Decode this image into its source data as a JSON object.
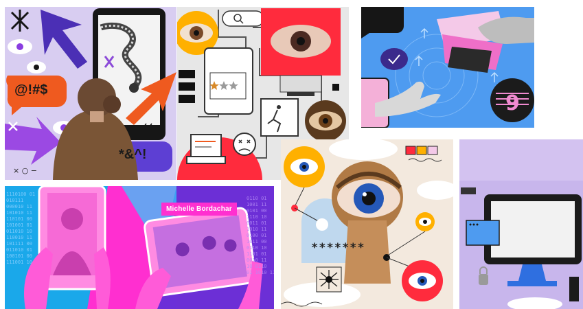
{
  "panels": {
    "chat_symbols": {
      "bubble_left": "@!#$",
      "bubble_right": "*&^!",
      "window_controls": "× ○ −"
    },
    "portrait": {
      "name_tag": "Michelle Bordachar",
      "binary_left": "1110100 01\n010111\n000010 11\n101010 11\n110101 00\n101001 01\n011010 10\n110010 11\n101111 00\n011010 01\n100101 00\n111001 10",
      "binary_right": "0110 01\n1001 11\n0101 00\n1110 10\n0011 01\n1010 11\n0100 01\n1011 00\n0110 10\n1101 01\n0010 11\n10 0110\n01 1010 11"
    },
    "keyhole": {
      "password_mask": "*******"
    }
  },
  "colors": {
    "lavender": "#d9ccf3",
    "purple": "#5d3fd3",
    "orange": "#ef5a1f",
    "red_alert": "#ff2b3d",
    "cream": "#f3e9de",
    "sky_blue": "#4e9bf0",
    "magenta": "#ff2fd0",
    "yellow": "#ffb000"
  }
}
